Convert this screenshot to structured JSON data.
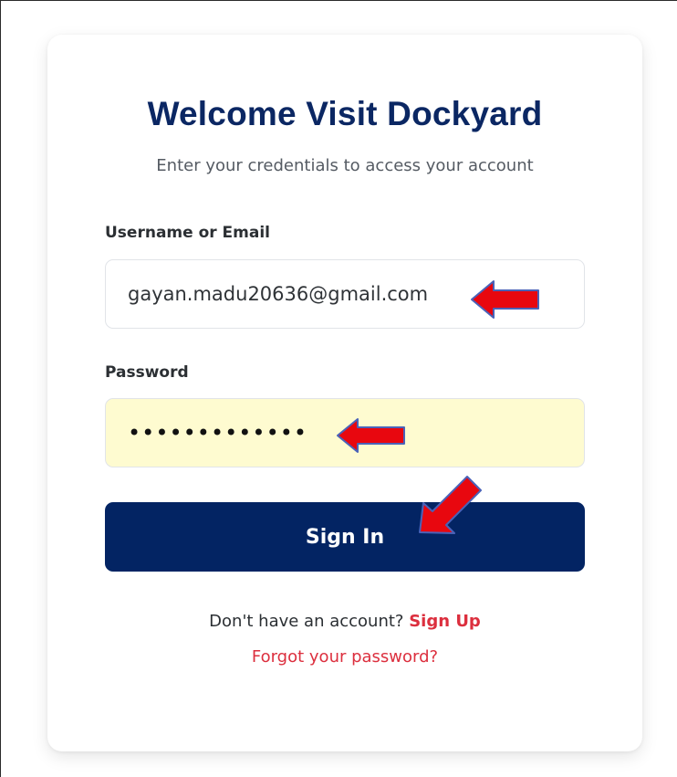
{
  "login": {
    "title": "Welcome Visit Dockyard",
    "subtitle": "Enter your credentials to access your account",
    "username_label": "Username or Email",
    "username_value": "gayan.madu20636@gmail.com",
    "password_label": "Password",
    "password_masked": "•••••••••••••",
    "sign_in_label": "Sign In",
    "no_account_text": "Don't have an account?",
    "sign_up_label": "Sign Up",
    "forgot_password_label": "Forgot your password?"
  },
  "colors": {
    "title": "#0b2763",
    "primary_button": "#032463",
    "link": "#dc2f3e",
    "autofill_bg": "#fefbd0",
    "annotation_arrow": "#e8070f",
    "annotation_outline": "#4a62b8"
  },
  "annotations": {
    "icon": "red-arrow-icon"
  }
}
